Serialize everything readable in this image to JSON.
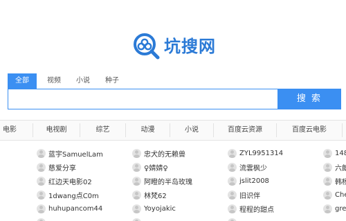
{
  "brand": {
    "name": "坑搜网",
    "logo_icon": "search-magnifier-cloud-icon",
    "color": "#2b7ad6"
  },
  "search": {
    "tabs": [
      {
        "label": "全部",
        "active": true
      },
      {
        "label": "视频",
        "active": false
      },
      {
        "label": "小说",
        "active": false
      },
      {
        "label": "种子",
        "active": false
      }
    ],
    "placeholder": "",
    "button_label": "搜 索",
    "accent": "#3b8ff2"
  },
  "categories": [
    "电影",
    "电视剧",
    "综艺",
    "动漫",
    "小说",
    "百度云资源",
    "百度云电影"
  ],
  "users": {
    "col1": [],
    "col2": [
      "蓝宇SamuelLam",
      "慈爱分享",
      "红边天电影02",
      "1dwang点C0m",
      "huhupancom44"
    ],
    "col3": [
      "忠犬的无赖兽",
      "♀婧婧♀",
      "阿瞪的半岛玫瑰",
      "林梵62",
      "Yoyojakic"
    ],
    "col4": [
      "ZYL9951314",
      "流雲枫少",
      "jslit2008",
      "旧识伴",
      "程程的甜点"
    ],
    "col5": [
      "148",
      "六朗",
      "韩杨",
      "Che",
      "gre"
    ]
  }
}
